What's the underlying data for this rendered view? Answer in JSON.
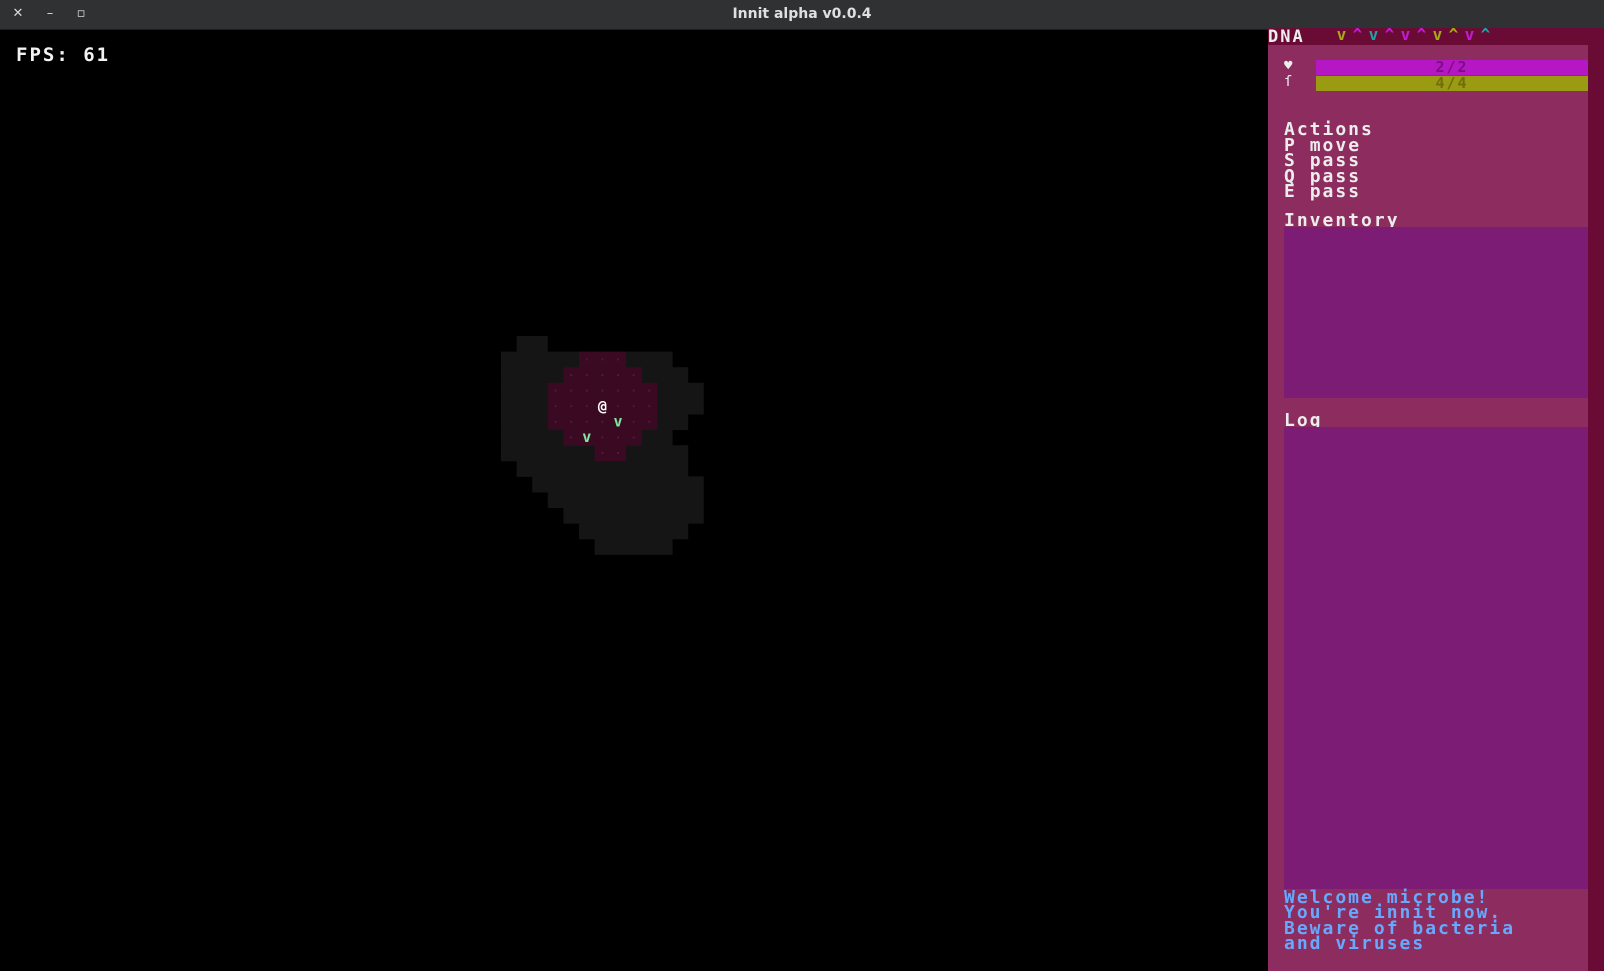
{
  "window": {
    "title": "Innit alpha v0.0.4",
    "close_glyph": "✕",
    "minimize_glyph": "–",
    "maximize_glyph": "▫"
  },
  "hud_fps": {
    "label": "FPS:",
    "value": "61"
  },
  "sidebar": {
    "dna_label": "DNA",
    "dna_sequence": [
      {
        "glyph": "v",
        "color": "#a8a813"
      },
      {
        "glyph": "^",
        "color": "#c21cd0"
      },
      {
        "glyph": "v",
        "color": "#1aa59e"
      },
      {
        "glyph": "^",
        "color": "#c21cd0"
      },
      {
        "glyph": "v",
        "color": "#c21cd0"
      },
      {
        "glyph": "^",
        "color": "#c21cd0"
      },
      {
        "glyph": "v",
        "color": "#a8a813"
      },
      {
        "glyph": "^",
        "color": "#a8a813"
      },
      {
        "glyph": "v",
        "color": "#c21cd0"
      },
      {
        "glyph": "^",
        "color": "#1aa59e"
      }
    ],
    "stats": [
      {
        "name": "health",
        "icon": "heart-icon",
        "glyph": "♥",
        "text": "2/2",
        "value": 2,
        "max": 2,
        "bar_color": "#b517c4",
        "text_color": "#7a0f85"
      },
      {
        "name": "energy",
        "icon": "flagellum-icon",
        "glyph": "ſ",
        "text": "4/4",
        "value": 4,
        "max": 4,
        "bar_color": "#9a9a13",
        "text_color": "#6e6e0c"
      }
    ],
    "actions_title": "Actions",
    "actions": [
      {
        "key": "P",
        "action": "move"
      },
      {
        "key": "S",
        "action": "pass"
      },
      {
        "key": "Q",
        "action": "pass"
      },
      {
        "key": "E",
        "action": "pass"
      }
    ],
    "inventory_title": "Inventory",
    "log_title": "Log",
    "log_messages": [
      "Welcome microbe!",
      "You're innit now.",
      "Beware of bacteria",
      "and viruses"
    ]
  },
  "map": {
    "player_glyph": "@",
    "creature_glyph": "v",
    "creature_color": "#7fe8a0",
    "floor_color": "#151515",
    "cell_color": "#3a0a22",
    "cell_dot_color": "#5b1434"
  }
}
